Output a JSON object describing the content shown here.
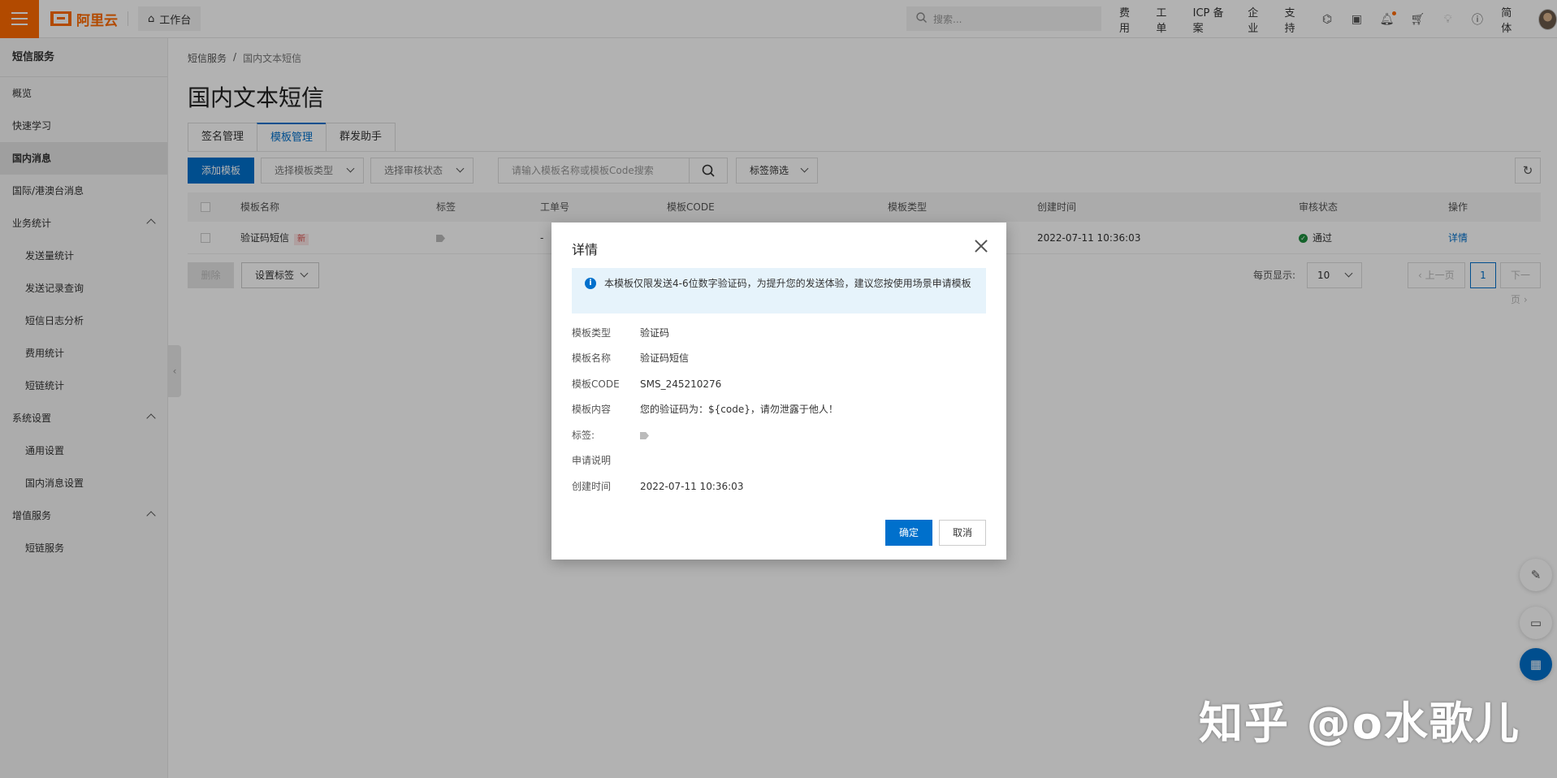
{
  "topbar": {
    "brand": "阿里云",
    "workbench": "工作台",
    "search_placeholder": "搜索...",
    "links": [
      "费用",
      "工单",
      "ICP 备案",
      "企业",
      "支持"
    ],
    "lang": "简体",
    "icons": [
      "terminal-icon",
      "image-icon",
      "bell-icon",
      "cart-icon",
      "lightbulb-icon",
      "help-icon"
    ]
  },
  "sidebar": {
    "title": "短信服务",
    "items": [
      {
        "label": "概览",
        "level": 0
      },
      {
        "label": "快速学习",
        "level": 0
      },
      {
        "label": "国内消息",
        "level": 0,
        "active": true
      },
      {
        "label": "国际/港澳台消息",
        "level": 0
      },
      {
        "label": "业务统计",
        "level": 0,
        "group": true
      },
      {
        "label": "发送量统计",
        "level": 1
      },
      {
        "label": "发送记录查询",
        "level": 1
      },
      {
        "label": "短信日志分析",
        "level": 1
      },
      {
        "label": "费用统计",
        "level": 1
      },
      {
        "label": "短链统计",
        "level": 1
      },
      {
        "label": "系统设置",
        "level": 0,
        "group": true
      },
      {
        "label": "通用设置",
        "level": 1
      },
      {
        "label": "国内消息设置",
        "level": 1
      },
      {
        "label": "增值服务",
        "level": 0,
        "group": true
      },
      {
        "label": "短链服务",
        "level": 1
      }
    ]
  },
  "main": {
    "breadcrumb": [
      "短信服务",
      "国内文本短信"
    ],
    "breadcrumb_sep": "/",
    "title": "国内文本短信",
    "tabs": [
      {
        "label": "签名管理",
        "active": false
      },
      {
        "label": "模板管理",
        "active": true
      },
      {
        "label": "群发助手",
        "active": false
      }
    ],
    "toolbar": {
      "add_label": "添加模板",
      "type_select": "选择模板类型",
      "status_select": "选择审核状态",
      "search_placeholder": "请输入模板名称或模板Code搜索",
      "tag_filter": "标签筛选"
    },
    "table": {
      "headers": [
        "模板名称",
        "标签",
        "工单号",
        "模板CODE",
        "模板类型",
        "创建时间",
        "审核状态",
        "操作"
      ],
      "rows": [
        {
          "name": "验证码短信",
          "badge": "新",
          "ticket": "-",
          "created": "2022-07-11 10:36:03",
          "status": "通过",
          "action": "详情"
        }
      ]
    },
    "bottom": {
      "delete_label": "删除",
      "set_tag_label": "设置标签",
      "page_size_label": "每页显示:",
      "page_size": "10",
      "prev": "上一页",
      "page": "1",
      "next": "下一页"
    }
  },
  "modal": {
    "title": "详情",
    "notice": "本模板仅限发送4-6位数字验证码，为提升您的发送体验，建议您按使用场景申请模板",
    "fields": [
      {
        "key": "模板类型",
        "value": "验证码"
      },
      {
        "key": "模板名称",
        "value": "验证码短信"
      },
      {
        "key": "模板CODE",
        "value": "SMS_245210276"
      },
      {
        "key": "模板内容",
        "value": "您的验证码为：${code}，请勿泄露于他人！"
      },
      {
        "key": "标签:",
        "value": ""
      },
      {
        "key": "申请说明",
        "value": ""
      },
      {
        "key": "创建时间",
        "value": "2022-07-11 10:36:03"
      }
    ],
    "ok_label": "确定",
    "cancel_label": "取消"
  },
  "watermark": "知乎 @o水歌儿",
  "colors": {
    "brand_orange": "#ff6a00",
    "primary_blue": "#0070cc",
    "success_green": "#1e8e3e"
  }
}
